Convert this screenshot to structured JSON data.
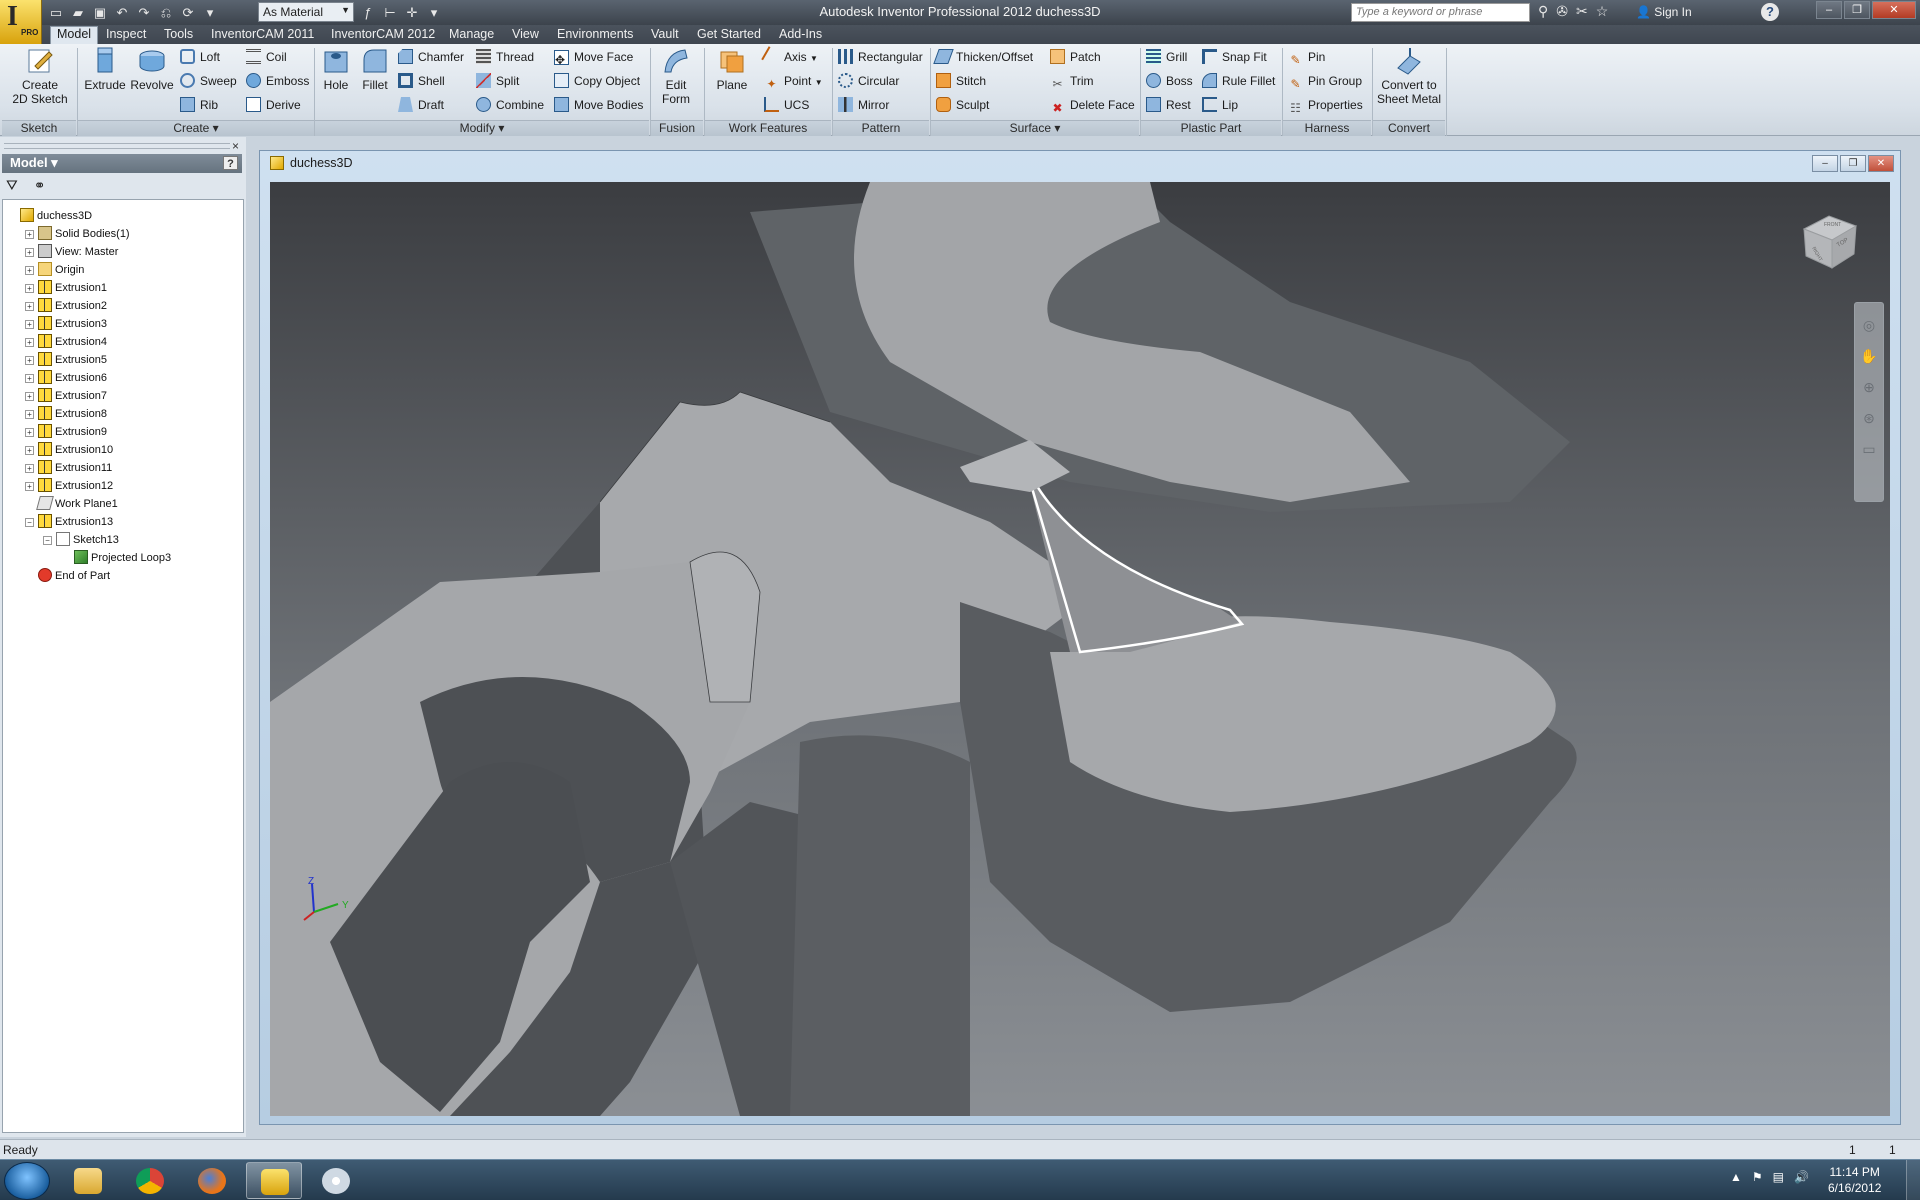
{
  "app": {
    "title": "Autodesk Inventor Professional 2012   duchess3D",
    "logo_letter": "I",
    "logo_badge": "PRO",
    "material": "As Material",
    "search_placeholder": "Type a keyword or phrase",
    "sign_in": "Sign In",
    "help": "?"
  },
  "menu": {
    "tabs": [
      "Model",
      "Inspect",
      "Tools",
      "InventorCAM 2011",
      "InventorCAM 2012",
      "Manage",
      "View",
      "Environments",
      "Vault",
      "Get Started",
      "Add-Ins"
    ],
    "active_tab": "Model"
  },
  "ribbon": {
    "sketch": {
      "label": "Sketch",
      "create_2d_sketch": "Create\n2D Sketch"
    },
    "create": {
      "label": "Create ▾",
      "extrude": "Extrude",
      "revolve": "Revolve",
      "loft": "Loft",
      "sweep": "Sweep",
      "rib": "Rib",
      "coil": "Coil",
      "emboss": "Emboss",
      "derive": "Derive"
    },
    "modify": {
      "label": "Modify ▾",
      "hole": "Hole",
      "fillet": "Fillet",
      "chamfer": "Chamfer",
      "shell": "Shell",
      "draft": "Draft",
      "thread": "Thread",
      "split": "Split",
      "combine": "Combine",
      "move_face": "Move Face",
      "copy_object": "Copy Object",
      "move_bodies": "Move Bodies"
    },
    "fusion": {
      "label": "Fusion",
      "edit_form": "Edit\nForm"
    },
    "work_features": {
      "label": "Work Features",
      "plane": "Plane",
      "axis": "Axis",
      "point": "Point",
      "ucs": "UCS"
    },
    "pattern": {
      "label": "Pattern",
      "rectangular": "Rectangular",
      "circular": "Circular",
      "mirror": "Mirror"
    },
    "surface": {
      "label": "Surface ▾",
      "thicken_offset": "Thicken/Offset",
      "stitch": "Stitch",
      "sculpt": "Sculpt",
      "patch": "Patch",
      "trim": "Trim",
      "delete_face": "Delete Face"
    },
    "plastic_part": {
      "label": "Plastic Part",
      "grill": "Grill",
      "boss": "Boss",
      "rest": "Rest",
      "snap_fit": "Snap Fit",
      "rule_fillet": "Rule Fillet",
      "lip": "Lip"
    },
    "harness": {
      "label": "Harness",
      "pin": "Pin",
      "pin_group": "Pin Group",
      "properties": "Properties"
    },
    "convert": {
      "label": "Convert",
      "convert_to_sheet_metal": "Convert to\nSheet Metal"
    }
  },
  "browser": {
    "title": "Model ▾",
    "close": "×",
    "help": "?",
    "tree": [
      {
        "label": "duchess3D",
        "icon": "part-icon",
        "indent": 0,
        "expander": ""
      },
      {
        "label": "Solid Bodies(1)",
        "icon": "solid-body-icon",
        "indent": 1,
        "expander": "+"
      },
      {
        "label": "View: Master",
        "icon": "view-icon",
        "indent": 1,
        "expander": "+"
      },
      {
        "label": "Origin",
        "icon": "folder-icon",
        "indent": 1,
        "expander": "+"
      },
      {
        "label": "Extrusion1",
        "icon": "extrusion-icon",
        "indent": 1,
        "expander": "+"
      },
      {
        "label": "Extrusion2",
        "icon": "extrusion-icon",
        "indent": 1,
        "expander": "+"
      },
      {
        "label": "Extrusion3",
        "icon": "extrusion-icon",
        "indent": 1,
        "expander": "+"
      },
      {
        "label": "Extrusion4",
        "icon": "extrusion-icon",
        "indent": 1,
        "expander": "+"
      },
      {
        "label": "Extrusion5",
        "icon": "extrusion-icon",
        "indent": 1,
        "expander": "+"
      },
      {
        "label": "Extrusion6",
        "icon": "extrusion-icon",
        "indent": 1,
        "expander": "+"
      },
      {
        "label": "Extrusion7",
        "icon": "extrusion-icon",
        "indent": 1,
        "expander": "+"
      },
      {
        "label": "Extrusion8",
        "icon": "extrusion-icon",
        "indent": 1,
        "expander": "+"
      },
      {
        "label": "Extrusion9",
        "icon": "extrusion-icon",
        "indent": 1,
        "expander": "+"
      },
      {
        "label": "Extrusion10",
        "icon": "extrusion-icon",
        "indent": 1,
        "expander": "+"
      },
      {
        "label": "Extrusion11",
        "icon": "extrusion-icon",
        "indent": 1,
        "expander": "+"
      },
      {
        "label": "Extrusion12",
        "icon": "extrusion-icon",
        "indent": 1,
        "expander": "+"
      },
      {
        "label": "Work Plane1",
        "icon": "work-plane-icon",
        "indent": 1,
        "expander": ""
      },
      {
        "label": "Extrusion13",
        "icon": "extrusion-icon",
        "indent": 1,
        "expander": "−"
      },
      {
        "label": "Sketch13",
        "icon": "sketch-icon",
        "indent": 2,
        "expander": "−"
      },
      {
        "label": "Projected Loop3",
        "icon": "projected-loop-icon",
        "indent": 3,
        "expander": ""
      },
      {
        "label": "End of Part",
        "icon": "end-of-part-icon",
        "indent": 1,
        "expander": ""
      }
    ]
  },
  "document": {
    "title": "duchess3D"
  },
  "viewcube": {
    "top": "TOP",
    "front": "FRONT",
    "right": "RIGHT"
  },
  "triad": {
    "z": "Z",
    "y": "Y"
  },
  "status": {
    "text": "Ready",
    "num1": "1",
    "num2": "1"
  },
  "clock": {
    "time": "11:14 PM",
    "date": "6/16/2012"
  },
  "colors": {
    "accent": "#2a4d7f",
    "selection_edge": "#ffffff",
    "model_face": "#a9abae",
    "model_side": "#56595d"
  }
}
